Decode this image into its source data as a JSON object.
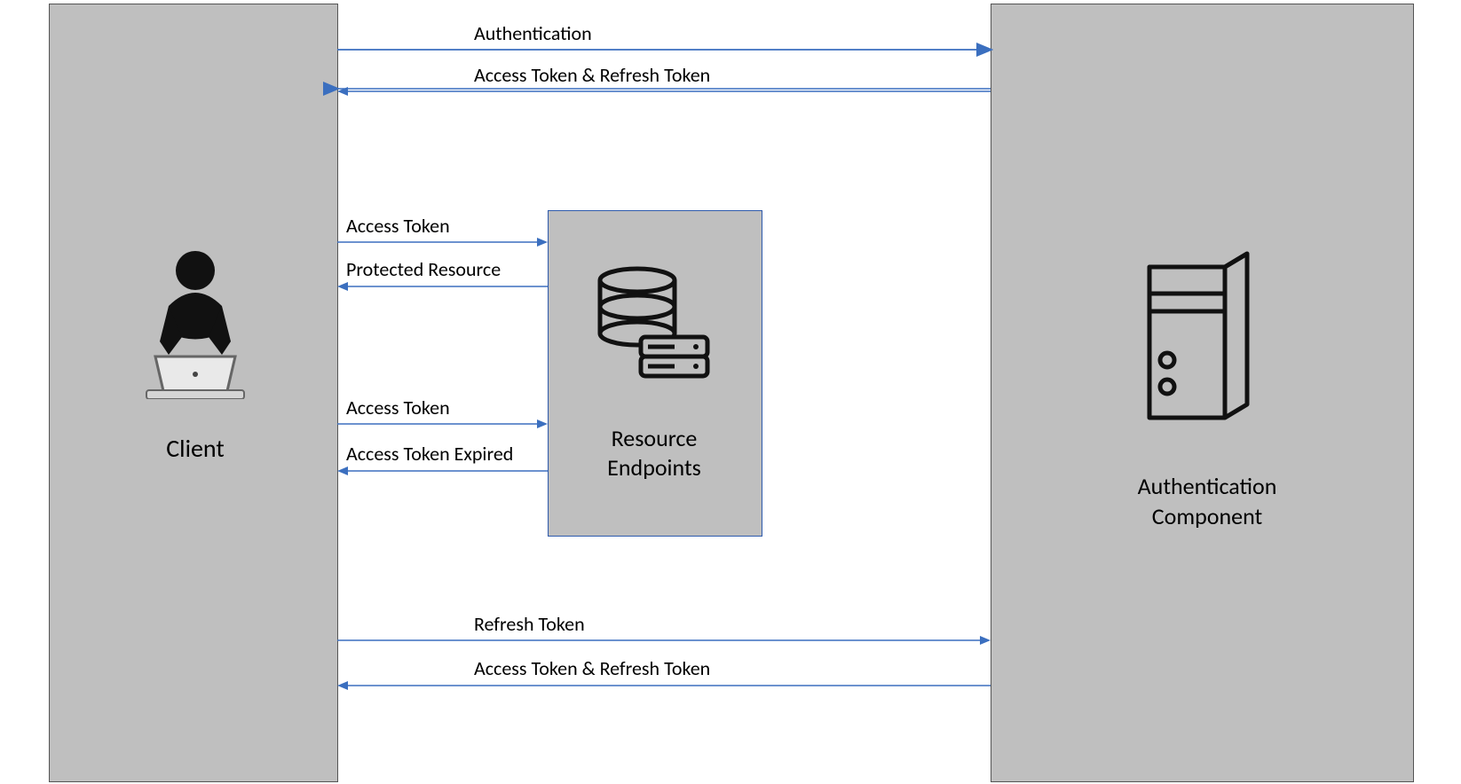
{
  "nodes": {
    "client": {
      "label": "Client"
    },
    "resource": {
      "line1": "Resource",
      "line2": "Endpoints"
    },
    "auth": {
      "line1": "Authentication",
      "line2": "Component"
    }
  },
  "arrows": {
    "a1": "Authentication",
    "a2": "Access Token & Refresh Token",
    "a3": "Access Token",
    "a4": "Protected Resource",
    "a5": "Access Token",
    "a6": "Access Token Expired",
    "a7": "Refresh Token",
    "a8": "Access Token & Refresh Token"
  },
  "colors": {
    "arrow": "#3b6fbf",
    "box": "#bfbfbf",
    "box_outline": "#555555",
    "resource_outline": "#2e5aac"
  }
}
